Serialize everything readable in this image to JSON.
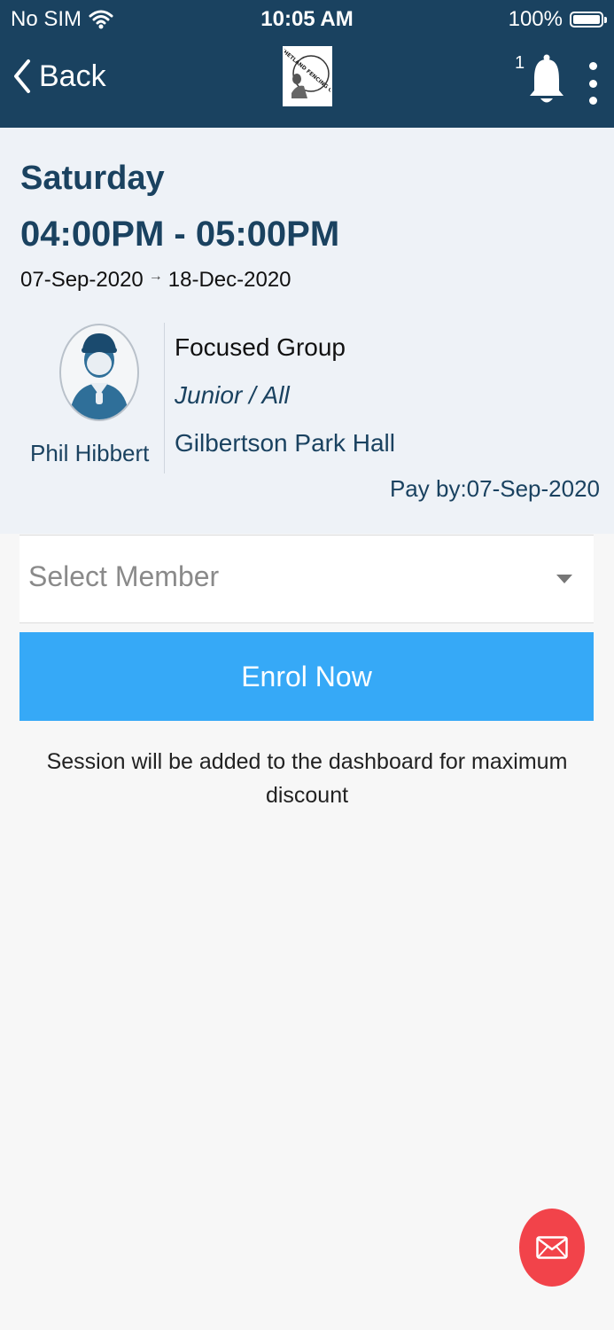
{
  "status_bar": {
    "carrier": "No SIM",
    "time": "10:05 AM",
    "battery": "100%"
  },
  "nav": {
    "back_label": "Back",
    "notification_count": "1",
    "logo_text": "SHETLAND FENCING CLUB"
  },
  "session": {
    "day": "Saturday",
    "time_range": "04:00PM - 05:00PM",
    "start_date": "07-Sep-2020",
    "end_date": "18-Dec-2020",
    "coach_name": "Phil Hibbert",
    "group_name": "Focused Group",
    "group_level": "Junior / All",
    "venue": "Gilbertson Park Hall",
    "pay_by": "Pay by:07-Sep-2020"
  },
  "form": {
    "member_placeholder": "Select Member",
    "enrol_label": "Enrol Now",
    "note": "Session will be added to the dashboard for maximum discount"
  },
  "colors": {
    "header": "#1a4260",
    "card_bg": "#eef2f7",
    "accent": "#36a9f7",
    "fab": "#f2434a"
  }
}
